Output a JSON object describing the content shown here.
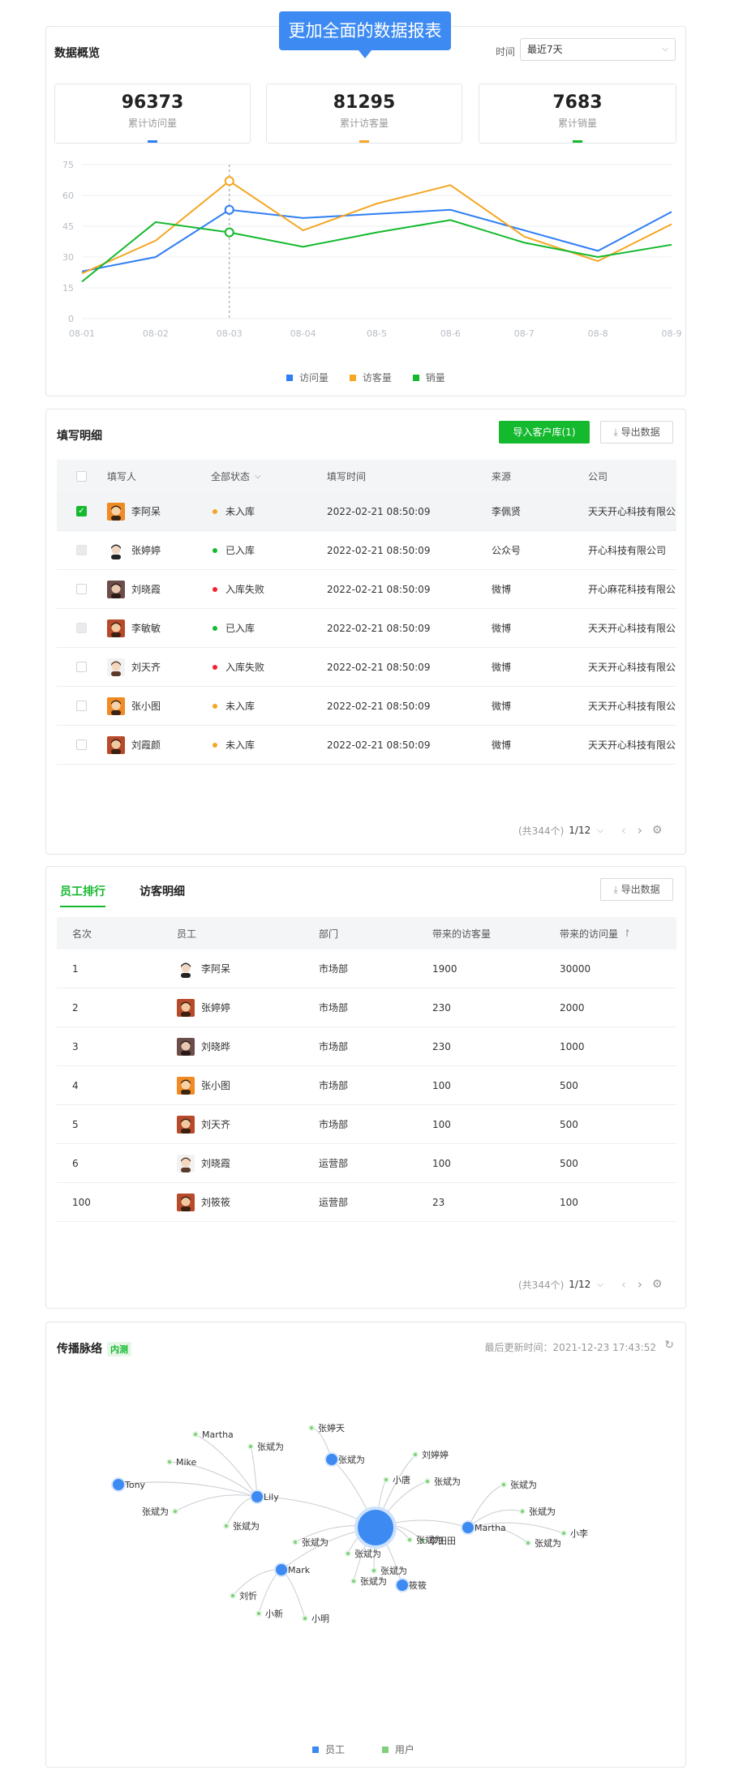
{
  "overview": {
    "title": "数据概览",
    "callout": "更加全面的数据报表",
    "time_label": "时间",
    "time_value": "最近7天",
    "stats": [
      {
        "value": "96373",
        "label": "累计访问量",
        "color": "#2f7ef5"
      },
      {
        "value": "81295",
        "label": "累计访客量",
        "color": "#f5a623"
      },
      {
        "value": "7683",
        "label": "累计销量",
        "color": "#14b92e"
      }
    ]
  },
  "chart_data": {
    "type": "line",
    "x": [
      "08-01",
      "08-02",
      "08-03",
      "08-04",
      "08-5",
      "08-6",
      "08-7",
      "08-8",
      "08-9"
    ],
    "ylim": [
      0,
      75
    ],
    "yticks": [
      "75",
      "60",
      "45",
      "30",
      "15",
      "0"
    ],
    "grid": true,
    "legend_position": "bottom",
    "series": [
      {
        "name": "访问量",
        "color": "#2f7ef5",
        "values": [
          23,
          30,
          53,
          49,
          51,
          53,
          43,
          33,
          52
        ]
      },
      {
        "name": "访客量",
        "color": "#f5a623",
        "values": [
          22,
          38,
          67,
          43,
          56,
          65,
          40,
          28,
          46
        ]
      },
      {
        "name": "销量",
        "color": "#14b92e",
        "values": [
          18,
          47,
          42,
          35,
          42,
          48,
          37,
          30,
          36
        ]
      }
    ]
  },
  "fill": {
    "title": "填写明细",
    "import_btn": "导入客户库(1)",
    "export_btn": "导出数据",
    "headers": [
      "填写人",
      "全部状态",
      "填写时间",
      "来源",
      "公司"
    ],
    "rows": [
      {
        "name": "李阿呆",
        "status": "未入库",
        "status_color": "#f5a623",
        "time": "2022-02-21 08:50:09",
        "source": "李佩贤",
        "company": "天天开心科技有限公司",
        "check": "on",
        "avatar": "a1"
      },
      {
        "name": "张婷婷",
        "status": "已入库",
        "status_color": "#14b92e",
        "time": "2022-02-21 08:50:09",
        "source": "公众号",
        "company": "开心科技有限公司",
        "check": "dis",
        "avatar": "a2"
      },
      {
        "name": "刘晓霞",
        "status": "入库失败",
        "status_color": "#f5222d",
        "time": "2022-02-21 08:50:09",
        "source": "微博",
        "company": "开心麻花科技有限公司",
        "check": "off",
        "avatar": "a3"
      },
      {
        "name": "李敏敏",
        "status": "已入库",
        "status_color": "#14b92e",
        "time": "2022-02-21 08:50:09",
        "source": "微博",
        "company": "天天开心科技有限公司",
        "check": "dis",
        "avatar": "a4"
      },
      {
        "name": "刘天齐",
        "status": "入库失败",
        "status_color": "#f5222d",
        "time": "2022-02-21 08:50:09",
        "source": "微博",
        "company": "天天开心科技有限公司",
        "check": "off",
        "avatar": "a5"
      },
      {
        "name": "张小图",
        "status": "未入库",
        "status_color": "#f5a623",
        "time": "2022-02-21 08:50:09",
        "source": "微博",
        "company": "天天开心科技有限公司",
        "check": "off",
        "avatar": "a1"
      },
      {
        "name": "刘霞颜",
        "status": "未入库",
        "status_color": "#f5a623",
        "time": "2022-02-21 08:50:09",
        "source": "微博",
        "company": "天天开心科技有限公司",
        "check": "off",
        "avatar": "a4"
      }
    ],
    "pager_total": "(共344个)",
    "pager_page": "1/12"
  },
  "staff": {
    "tabs": [
      "员工排行",
      "访客明细"
    ],
    "export_btn": "导出数据",
    "headers": [
      "名次",
      "员工",
      "部门",
      "带来的访客量",
      "带来的访问量"
    ],
    "rows": [
      {
        "rank": "1",
        "name": "李阿呆",
        "dept": "市场部",
        "visitors": "1900",
        "visits": "30000",
        "avatar": "a2"
      },
      {
        "rank": "2",
        "name": "张婷婷",
        "dept": "市场部",
        "visitors": "230",
        "visits": "2000",
        "avatar": "a4"
      },
      {
        "rank": "3",
        "name": "刘晓晔",
        "dept": "市场部",
        "visitors": "230",
        "visits": "1000",
        "avatar": "a3"
      },
      {
        "rank": "4",
        "name": "张小图",
        "dept": "市场部",
        "visitors": "100",
        "visits": "500",
        "avatar": "a1"
      },
      {
        "rank": "5",
        "name": "刘天齐",
        "dept": "市场部",
        "visitors": "100",
        "visits": "500",
        "avatar": "a4"
      },
      {
        "rank": "6",
        "name": "刘晓霞",
        "dept": "运营部",
        "visitors": "100",
        "visits": "500",
        "avatar": "a5"
      },
      {
        "rank": "100",
        "name": "刘筱筱",
        "dept": "运营部",
        "visitors": "23",
        "visits": "100",
        "avatar": "a4"
      }
    ],
    "pager_total": "(共344个)",
    "pager_page": "1/12"
  },
  "network": {
    "title": "传播脉络",
    "badge": "内测",
    "updated": "最后更新时间：2021-12-23 17:43:52",
    "legend": [
      {
        "label": "员工",
        "color": "#3d8bf2"
      },
      {
        "label": "用户",
        "color": "#7ed07a"
      }
    ],
    "labels": [
      "张婷天",
      "张斌为",
      "刘婷婷",
      "Martha",
      "张斌为",
      "Mike",
      "Tony",
      "Lily",
      "小唐",
      "张斌为",
      "张斌为",
      "张斌为",
      "张斌为",
      "张斌为",
      "Martha",
      "小李",
      "张斌为",
      "张斌为",
      "张斌为",
      "李田田",
      "Mark",
      "张斌为",
      "筱筱",
      "刘忻",
      "小新",
      "小明",
      "张斌为",
      "张斌为"
    ]
  }
}
